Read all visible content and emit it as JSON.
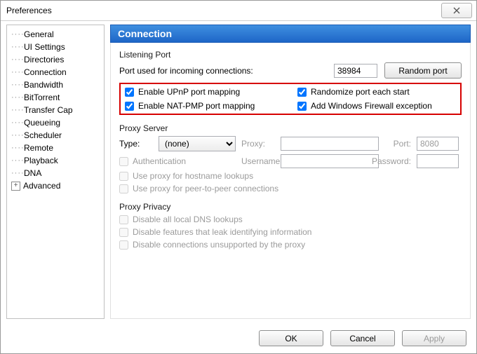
{
  "window": {
    "title": "Preferences"
  },
  "sidebar": {
    "items": [
      {
        "label": "General"
      },
      {
        "label": "UI Settings"
      },
      {
        "label": "Directories"
      },
      {
        "label": "Connection"
      },
      {
        "label": "Bandwidth"
      },
      {
        "label": "BitTorrent"
      },
      {
        "label": "Transfer Cap"
      },
      {
        "label": "Queueing"
      },
      {
        "label": "Scheduler"
      },
      {
        "label": "Remote"
      },
      {
        "label": "Playback"
      },
      {
        "label": "DNA"
      },
      {
        "label": "Advanced",
        "expandable": true
      }
    ]
  },
  "panel": {
    "title": "Connection",
    "listening": {
      "group_title": "Listening Port",
      "port_label": "Port used for incoming connections:",
      "port_value": "38984",
      "random_button": "Random port",
      "opt_upnp": "Enable UPnP port mapping",
      "opt_randomize": "Randomize port each start",
      "opt_natpmp": "Enable NAT-PMP port mapping",
      "opt_firewall": "Add Windows Firewall exception"
    },
    "proxy": {
      "group_title": "Proxy Server",
      "type_label": "Type:",
      "type_value": "(none)",
      "proxy_label": "Proxy:",
      "port_label": "Port:",
      "port_value": "8080",
      "auth_label": "Authentication",
      "user_label": "Username:",
      "pass_label": "Password:",
      "hostname_label": "Use proxy for hostname lookups",
      "p2p_label": "Use proxy for peer-to-peer connections"
    },
    "privacy": {
      "group_title": "Proxy Privacy",
      "dns_label": "Disable all local DNS lookups",
      "leak_label": "Disable features that leak identifying information",
      "unsup_label": "Disable connections unsupported by the proxy"
    }
  },
  "footer": {
    "ok": "OK",
    "cancel": "Cancel",
    "apply": "Apply"
  }
}
